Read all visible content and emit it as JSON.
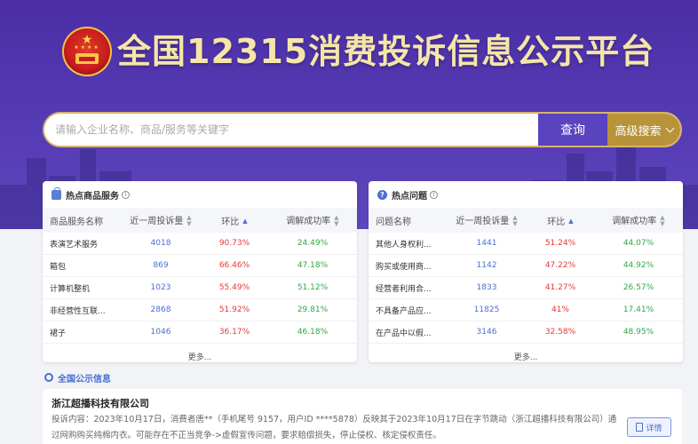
{
  "header": {
    "title": "全国12315消费投诉信息公示平台"
  },
  "search": {
    "placeholder": "请输入企业名称、商品/服务等关键字",
    "query_label": "查询",
    "advanced_label": "高级搜索"
  },
  "hot_products": {
    "title": "热点商品服务",
    "columns": [
      "商品服务名称",
      "近一周投诉量",
      "环比",
      "调解成功率"
    ],
    "rows": [
      {
        "name": "表演艺术服务",
        "count": "4018",
        "ratio": "90.73%",
        "rate": "24.49%"
      },
      {
        "name": "箱包",
        "count": "869",
        "ratio": "66.46%",
        "rate": "47.18%"
      },
      {
        "name": "计算机整机",
        "count": "1023",
        "ratio": "55.49%",
        "rate": "51.12%"
      },
      {
        "name": "非经营性互联...",
        "count": "2868",
        "ratio": "51.92%",
        "rate": "29.81%"
      },
      {
        "name": "裙子",
        "count": "1046",
        "ratio": "36.17%",
        "rate": "46.18%"
      }
    ],
    "more_label": "更多..."
  },
  "hot_issues": {
    "title": "热点问题",
    "columns": [
      "问题名称",
      "近一周投诉量",
      "环比",
      "调解成功率"
    ],
    "rows": [
      {
        "name": "其他人身权利...",
        "count": "1441",
        "ratio": "51.24%",
        "rate": "44.07%"
      },
      {
        "name": "购买或使用商...",
        "count": "1142",
        "ratio": "47.22%",
        "rate": "44.92%"
      },
      {
        "name": "经营者利用合...",
        "count": "1833",
        "ratio": "41.27%",
        "rate": "26.57%"
      },
      {
        "name": "不具备产品应...",
        "count": "11825",
        "ratio": "41%",
        "rate": "17.41%"
      },
      {
        "name": "在产品中以假...",
        "count": "3146",
        "ratio": "32.58%",
        "rate": "48.95%"
      }
    ],
    "more_label": "更多..."
  },
  "announcements": {
    "title": "全国公示信息",
    "notice": {
      "company": "浙江超播科技有限公司",
      "body": "投诉内容：2023年10月17日，消费者唐**（手机尾号 9157，用户ID ****5878）反映其于2023年10月17日在字节跳动（浙江超播科技有限公司）通过网购购买纯棉内衣。可能存在不正当竞争->虚假宣传问题，要求赔偿损失，停止侵权、核定侵权责任。",
      "detail_label": "详情"
    }
  },
  "colors": {
    "banner": "#4b2ea6",
    "title_gold": "#f5e6a8",
    "search_button": "#5a43bf",
    "advanced_button": "#b8933a",
    "count_blue": "#4a6fd0",
    "ratio_red": "#e23b3b",
    "rate_green": "#2fa948"
  }
}
